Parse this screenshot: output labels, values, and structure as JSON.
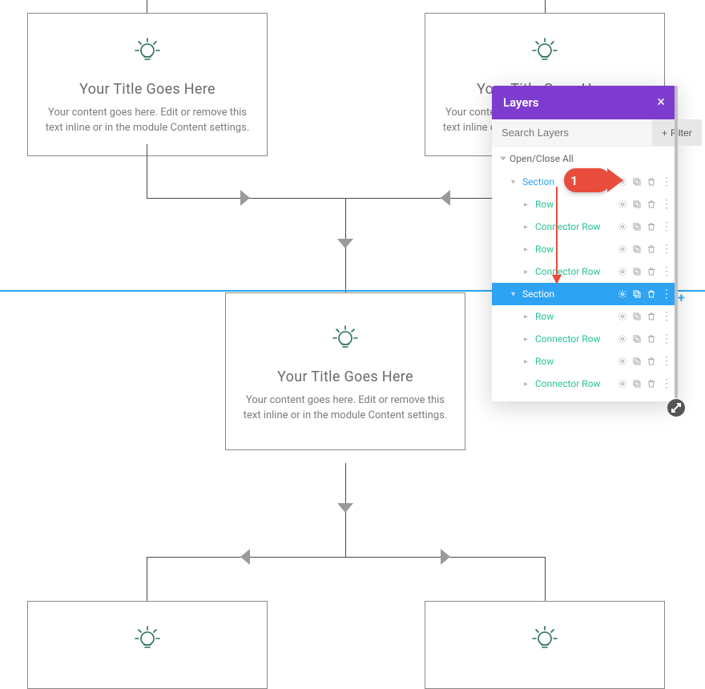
{
  "blurb": {
    "title": "Your Title Goes Here",
    "content": "Your content goes here. Edit or remove this text inline or in the module Content settings."
  },
  "layers_panel": {
    "title": "Layers",
    "search_placeholder": "Search Layers",
    "filter_label": "Filter",
    "open_close_all": "Open/Close All",
    "items": [
      {
        "label": "Section",
        "indent": 0,
        "blue": true,
        "selected": false,
        "caret": "down"
      },
      {
        "label": "Row",
        "indent": 1,
        "blue": false,
        "selected": false,
        "caret": "right"
      },
      {
        "label": "Connector Row",
        "indent": 1,
        "blue": false,
        "selected": false,
        "caret": "right"
      },
      {
        "label": "Row",
        "indent": 1,
        "blue": false,
        "selected": false,
        "caret": "right"
      },
      {
        "label": "Connector Row",
        "indent": 1,
        "blue": false,
        "selected": false,
        "caret": "right"
      },
      {
        "label": "Section",
        "indent": 0,
        "blue": true,
        "selected": true,
        "caret": "down"
      },
      {
        "label": "Row",
        "indent": 1,
        "blue": false,
        "selected": false,
        "caret": "right"
      },
      {
        "label": "Connector Row",
        "indent": 1,
        "blue": false,
        "selected": false,
        "caret": "right"
      },
      {
        "label": "Row",
        "indent": 1,
        "blue": false,
        "selected": false,
        "caret": "right"
      },
      {
        "label": "Connector Row",
        "indent": 1,
        "blue": false,
        "selected": false,
        "caret": "right"
      }
    ]
  },
  "callout_number": "1",
  "colors": {
    "accent_blue": "#2ea3f2",
    "accent_green": "#2bc29b",
    "panel_purple": "#7e3bd0",
    "callout_red": "#e74c3c"
  }
}
